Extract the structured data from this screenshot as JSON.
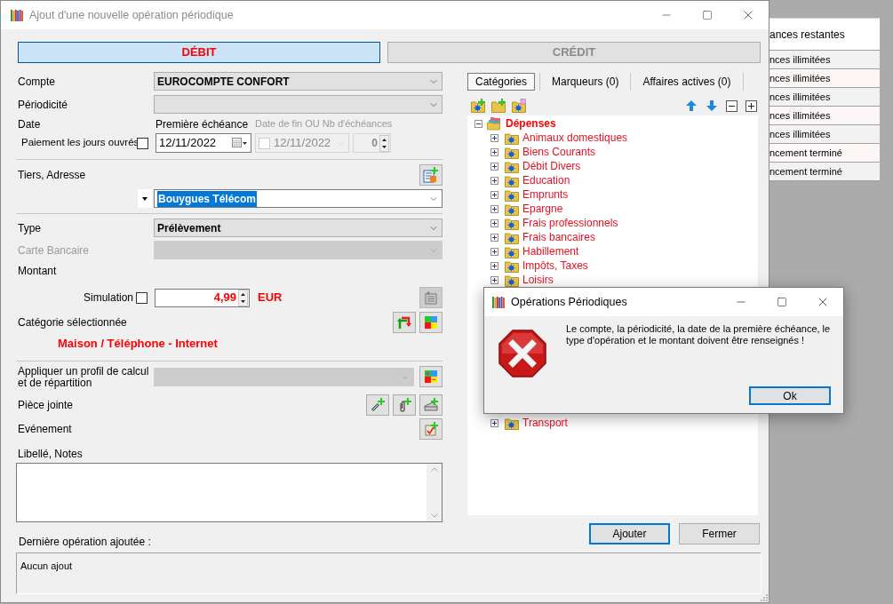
{
  "window": {
    "title": "Ajout d'une nouvelle opération périodique"
  },
  "direction_buttons": [
    {
      "label": "DÉBIT",
      "selected": true
    },
    {
      "label": "CRÉDIT",
      "selected": false
    }
  ],
  "form": {
    "compte": {
      "label": "Compte",
      "value": "EUROCOMPTE CONFORT"
    },
    "periodicite": {
      "label": "Périodicité"
    },
    "date": {
      "label": "Date",
      "first_due_label": "Première échéance",
      "end_label": "Date de fin OU Nb d'échéances",
      "business_days_label": "Paiement les jours ouvrés",
      "business_days_checked": false,
      "first_due": "12/11/2022",
      "end_date": "12/11/2022",
      "end_date_enabled": false,
      "count": "0"
    },
    "tiers": {
      "label": "Tiers, Adresse",
      "value": "Bouygues Télécom",
      "value_highlighted": true
    },
    "type": {
      "label": "Type",
      "value": "Prélèvement"
    },
    "carte": {
      "label": "Carte Bancaire",
      "disabled": true
    },
    "montant": {
      "label": "Montant",
      "simulation_label": "Simulation",
      "simulation_checked": false,
      "amount": "4,99",
      "currency": "EUR"
    },
    "categorie": {
      "label": "Catégorie sélectionnée",
      "value": "Maison / Téléphone - Internet"
    },
    "profil": {
      "label": "Appliquer un profil de calcul et de répartition"
    },
    "piece_jointe": {
      "label": "Pièce jointe"
    },
    "evenement": {
      "label": "Evénement"
    },
    "notes": {
      "label": "Libellé, Notes"
    }
  },
  "last_operation": {
    "label": "Dernière opération ajoutée :",
    "value": "Aucun ajout"
  },
  "side_tabs": [
    {
      "label": "Catégories",
      "selected": true
    },
    {
      "label": "Marqueurs (0)",
      "selected": false
    },
    {
      "label": "Affaires actives (0)",
      "selected": false
    }
  ],
  "category_tree": {
    "label": "Dépenses",
    "expanded": true,
    "children": [
      {
        "label": "Animaux domestiques",
        "expanded": false
      },
      {
        "label": "Biens Courants",
        "expanded": false
      },
      {
        "label": "Débit Divers",
        "expanded": false
      },
      {
        "label": "Education",
        "expanded": false
      },
      {
        "label": "Emprunts",
        "expanded": false
      },
      {
        "label": "Epargne",
        "expanded": false
      },
      {
        "label": "Frais professionnels",
        "expanded": false
      },
      {
        "label": "Frais bancaires",
        "expanded": false
      },
      {
        "label": "Habillement",
        "expanded": false
      },
      {
        "label": "Impôts, Taxes",
        "expanded": false
      },
      {
        "label": "Loisirs",
        "expanded": false
      },
      {
        "label": "Transport",
        "expanded": false
      }
    ]
  },
  "buttons": [
    {
      "label": "Ajouter",
      "default": true
    },
    {
      "label": "Fermer",
      "default": false
    }
  ],
  "dialog": {
    "title": "Opérations Périodiques",
    "message": "Le compte, la périodicité, la date de la première échéance, le type d'opération et le montant doivent être renseignés !",
    "button": {
      "label": "Ok",
      "default": true
    }
  },
  "background_table": {
    "header": "ances restantes",
    "rows": [
      "nces illimitées",
      "nces illimitées",
      "nces illimitées",
      "nces illimitées",
      "nces illimitées",
      "ncement terminé",
      "ncement terminé"
    ]
  }
}
